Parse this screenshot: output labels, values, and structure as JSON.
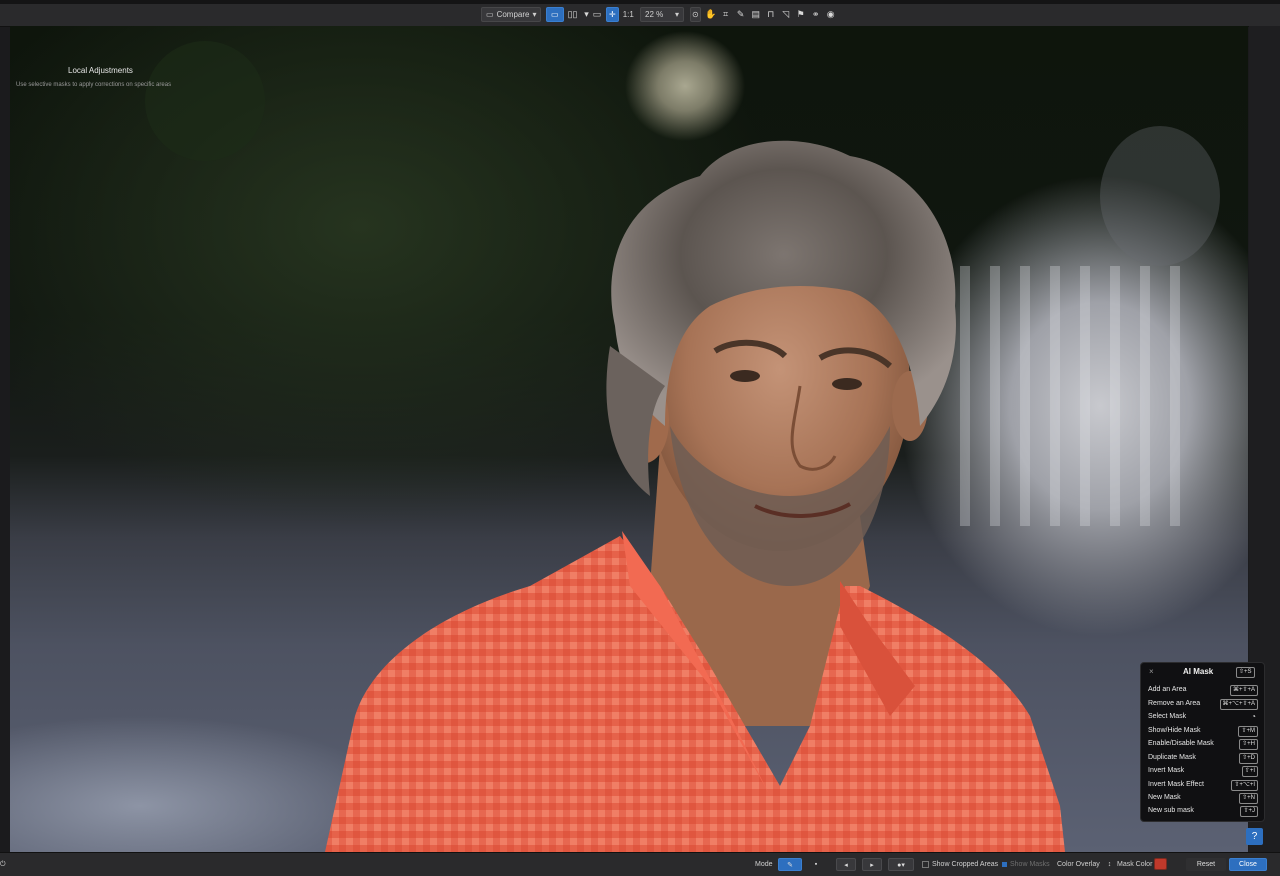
{
  "toolbar": {
    "compare_label": "Compare",
    "zoom_ratio": "1:1",
    "zoom_value": "22 %"
  },
  "overlay": {
    "title": "Local Adjustments",
    "subtitle": "Use selective masks to apply corrections on specific areas"
  },
  "ai_mask_panel": {
    "title": "AI Mask",
    "title_shortcut": "⇧+S",
    "items": [
      {
        "label": "Add an Area",
        "shortcut": "⌘+⇧+A"
      },
      {
        "label": "Remove an Area",
        "shortcut": "⌘+⌥+⇧+A"
      },
      {
        "label": "Select Mask",
        "shortcut": ""
      },
      {
        "label": "Show/Hide Mask",
        "shortcut": "⇧+M"
      },
      {
        "label": "Enable/Disable Mask",
        "shortcut": "⇧+H"
      },
      {
        "label": "Duplicate Mask",
        "shortcut": "⇧+D"
      },
      {
        "label": "Invert Mask",
        "shortcut": "⇧+I"
      },
      {
        "label": "Invert Mask Effect",
        "shortcut": "⇧+⌥+I"
      },
      {
        "label": "New Mask",
        "shortcut": "⇧+N"
      },
      {
        "label": "New sub mask",
        "shortcut": "⇧+J"
      }
    ]
  },
  "bottom": {
    "mode_label": "Mode",
    "show_cropped": "Show Cropped Areas",
    "show_masks": "Show Masks",
    "color_overlay": "Color Overlay",
    "mask_color_label": "Mask Color",
    "mask_color": "#c0392b",
    "reset": "Reset",
    "close": "Close"
  },
  "help": "?"
}
